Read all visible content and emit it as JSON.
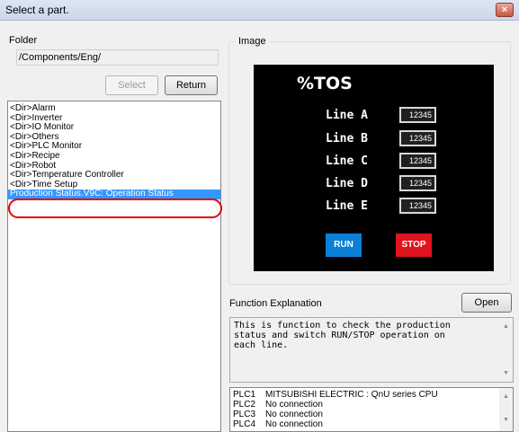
{
  "window": {
    "title": "Select a part.",
    "close_glyph": "×"
  },
  "folder": {
    "label": "Folder",
    "path": "/Components/Eng/"
  },
  "buttons": {
    "select": "Select",
    "return": "Return",
    "open": "Open"
  },
  "list": {
    "items": [
      "<Dir>Alarm",
      "<Dir>Inverter",
      "<Dir>IO Monitor",
      "<Dir>Others",
      "<Dir>PLC Monitor",
      "<Dir>Recipe",
      "<Dir>Robot",
      "<Dir>Temperature Controller",
      "<Dir>Time Setup",
      "Production Status.V9C: Operation Status"
    ],
    "selected_index": 9
  },
  "image": {
    "label": "Image",
    "title": "%TOS",
    "lines": [
      {
        "label": "Line A",
        "value": "12345"
      },
      {
        "label": "Line B",
        "value": "12345"
      },
      {
        "label": "Line C",
        "value": "12345"
      },
      {
        "label": "Line D",
        "value": "12345"
      },
      {
        "label": "Line E",
        "value": "12345"
      }
    ],
    "run_label": "RUN",
    "stop_label": "STOP"
  },
  "function_explanation": {
    "label": "Function Explanation",
    "text": "This is function to check the production\nstatus and switch RUN/STOP operation on\neach line."
  },
  "plc": [
    {
      "id": "PLC1",
      "value": "MITSUBISHI ELECTRIC : QnU series CPU"
    },
    {
      "id": "PLC2",
      "value": "No connection"
    },
    {
      "id": "PLC3",
      "value": "No connection"
    },
    {
      "id": "PLC4",
      "value": "No connection"
    }
  ],
  "colors": {
    "selection": "#3399ff",
    "highlight_ring": "#e60000",
    "run": "#0a7fd8",
    "stop": "#e0141e"
  }
}
